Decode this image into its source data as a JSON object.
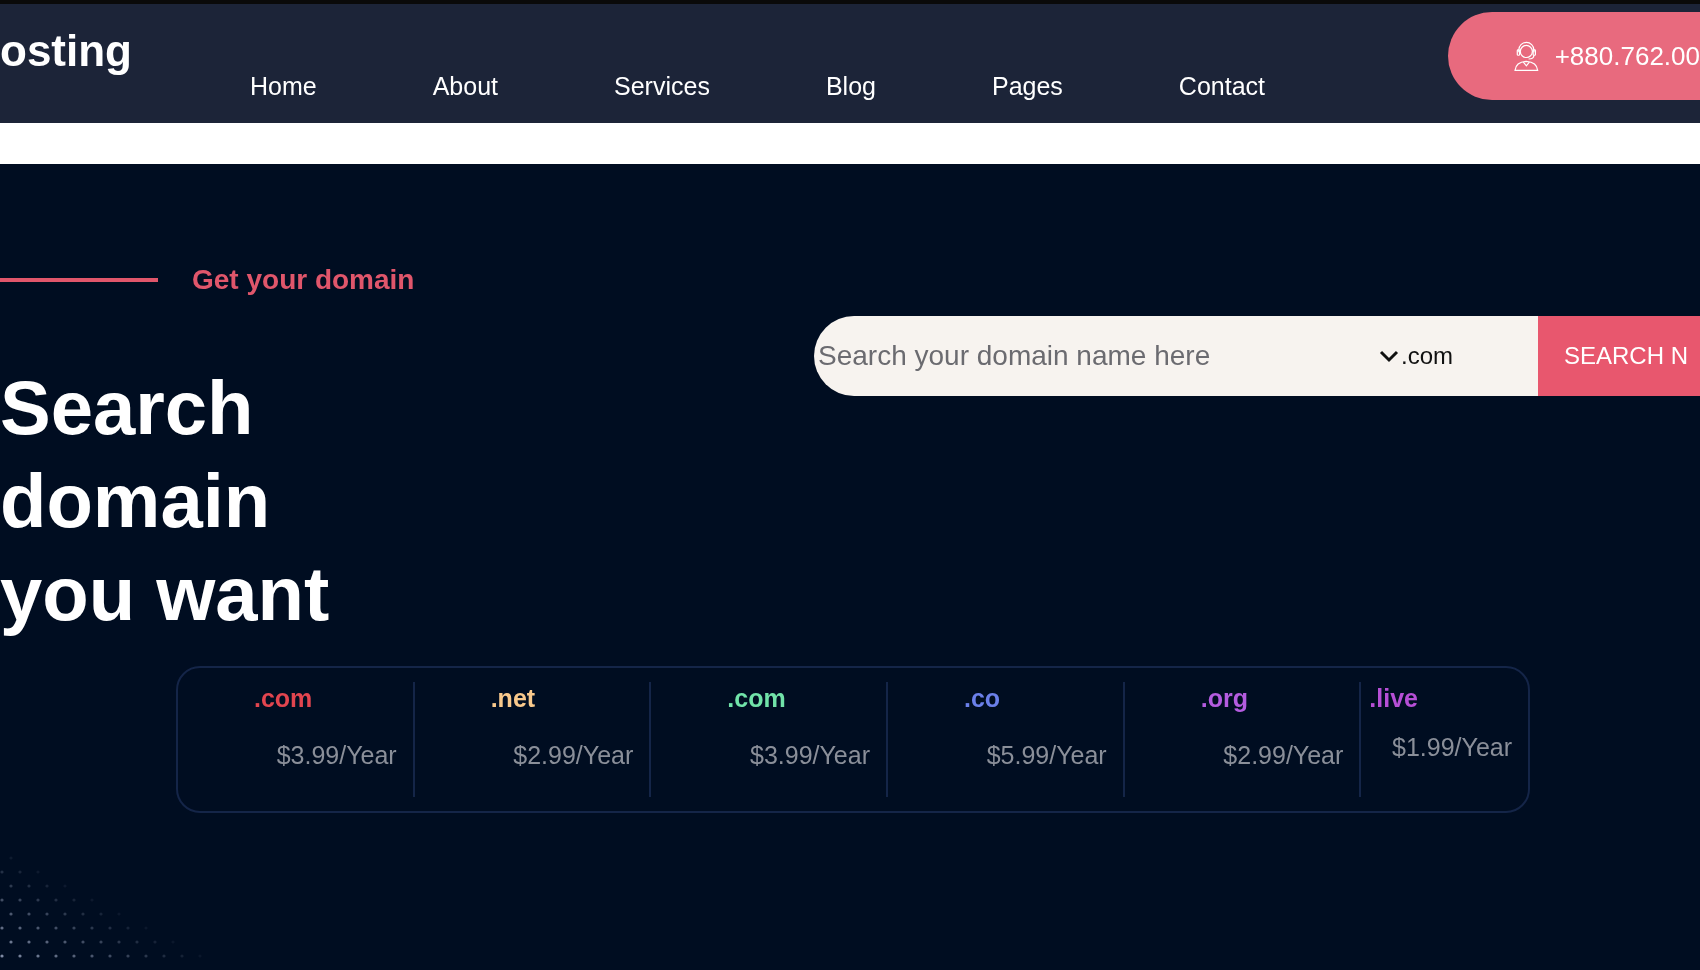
{
  "header": {
    "logo": "osting",
    "nav": [
      {
        "label": "Home"
      },
      {
        "label": "About"
      },
      {
        "label": "Services"
      },
      {
        "label": "Blog"
      },
      {
        "label": "Pages"
      },
      {
        "label": "Contact"
      }
    ],
    "phone": "+880.762.00"
  },
  "hero": {
    "eyebrow": "Get your domain",
    "heading": [
      "Search",
      "domain",
      "you want"
    ],
    "search": {
      "placeholder": "Search your domain name here",
      "extension": ".com",
      "button": "SEARCH N"
    },
    "domains": [
      {
        "tld": ".com",
        "price": "$3.99/Year",
        "color": "#e2454f"
      },
      {
        "tld": ".net",
        "price": "$2.99/Year",
        "color": "#f9c98c"
      },
      {
        "tld": ".com",
        "price": "$3.99/Year",
        "color": "#71e3a9"
      },
      {
        "tld": ".co",
        "price": "$5.99/Year",
        "color": "#6b80ea"
      },
      {
        "tld": ".org",
        "price": "$2.99/Year",
        "color": "#b45ce0"
      },
      {
        "tld": ".live",
        "price": "$1.99/Year",
        "color": "#b64fd6"
      }
    ]
  }
}
